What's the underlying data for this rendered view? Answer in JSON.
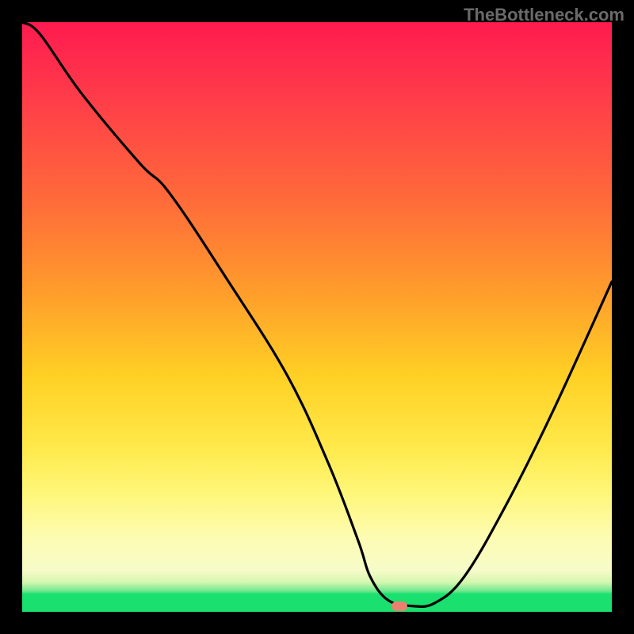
{
  "watermark_text": "TheBottleneck.com",
  "chart_data": {
    "type": "line",
    "title": "",
    "xlabel": "",
    "ylabel": "",
    "x_range": [
      0,
      100
    ],
    "y_range": [
      0,
      100
    ],
    "legend": false,
    "grid": false,
    "background": "red-yellow-green vertical gradient (bottleneck heatmap)",
    "series": [
      {
        "name": "bottleneck-curve",
        "x": [
          0,
          3,
          10,
          20,
          25,
          35,
          45,
          52,
          57,
          59,
          62,
          66,
          70,
          75,
          82,
          90,
          100
        ],
        "y": [
          100,
          98,
          88,
          76,
          71,
          56,
          40,
          25,
          12,
          6,
          2,
          1,
          1.5,
          6,
          18,
          34,
          56
        ]
      }
    ],
    "marker": {
      "name": "optimal-point",
      "x": 64,
      "y": 1,
      "color": "#ec806f"
    },
    "notes": "Values are estimated from pixel positions; chart has no visible axis ticks or labels. y=0 corresponds to the green band (no bottleneck), y=100 to the red top (severe bottleneck)."
  },
  "colors": {
    "frame": "#000000",
    "watermark": "#6a6a6a",
    "curve_stroke": "#000000",
    "marker_fill": "#ec806f"
  }
}
